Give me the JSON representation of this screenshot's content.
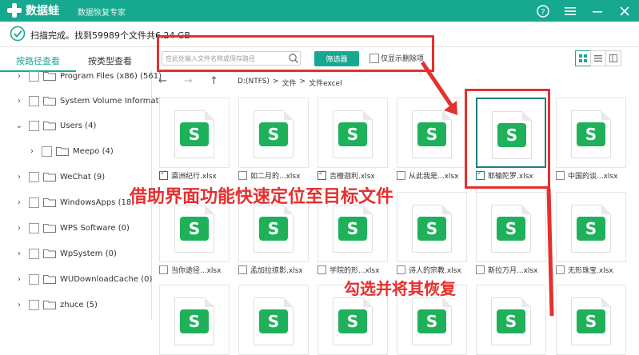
{
  "app": {
    "name": "数据蛙",
    "subtitle": "数据恢复专家"
  },
  "titlebar_icons": [
    "help-icon",
    "menu-icon",
    "minimize-icon",
    "close-icon"
  ],
  "status": {
    "text": "扫描完成。找到59989个文件共6.24 GB"
  },
  "tabs": [
    {
      "label": "按路径查看",
      "active": true
    },
    {
      "label": "按类型查看",
      "active": false
    }
  ],
  "tree": [
    {
      "label": "Program Files (x86) (561)",
      "expanded": false,
      "level": 0
    },
    {
      "label": "System Volume Informatio",
      "expanded": false,
      "level": 0
    },
    {
      "label": "Users (4)",
      "expanded": true,
      "level": 0
    },
    {
      "label": "Meepo (4)",
      "expanded": false,
      "level": 1
    },
    {
      "label": "WeChat (9)",
      "expanded": false,
      "level": 0
    },
    {
      "label": "WindowsApps (18)",
      "expanded": false,
      "level": 0
    },
    {
      "label": "WPS Software (0)",
      "expanded": false,
      "level": 0
    },
    {
      "label": "WpSystem (0)",
      "expanded": false,
      "level": 0
    },
    {
      "label": "WUDownloadCache (0)",
      "expanded": false,
      "level": 0
    },
    {
      "label": "zhuce (5)",
      "expanded": false,
      "level": 0
    }
  ],
  "search": {
    "placeholder": "在此处输入文件名称或保存路径"
  },
  "filter_button": "筛选器",
  "deleted_only_label": "仅显示删除项",
  "breadcrumb": [
    "D:(NTFS)",
    ">",
    "文件",
    ">",
    "文件excel"
  ],
  "files": [
    {
      "name": "瀛洲纪行.xlsx",
      "checked": true,
      "selected": false
    },
    {
      "name": "如二月的...xlsx",
      "checked": false,
      "selected": false
    },
    {
      "name": "吉檀迦利.xlsx",
      "checked": true,
      "selected": false
    },
    {
      "name": "从此我是...xlsx",
      "checked": false,
      "selected": false
    },
    {
      "name": "耶输陀罗.xlsx",
      "checked": true,
      "selected": true
    },
    {
      "name": "中国的谈...xlsx",
      "checked": false,
      "selected": false
    },
    {
      "name": "当你途径...xlsx",
      "checked": false,
      "selected": false
    },
    {
      "name": "孟加拉掠影.xlsx",
      "checked": false,
      "selected": false
    },
    {
      "name": "学院的形...xlsx",
      "checked": false,
      "selected": false
    },
    {
      "name": "诗人的宗教.xlsx",
      "checked": false,
      "selected": false
    },
    {
      "name": "斯拉万月...xlsx",
      "checked": false,
      "selected": false
    },
    {
      "name": "无形珠宝.xlsx",
      "checked": false,
      "selected": false
    },
    {
      "name": "",
      "checked": false,
      "selected": false
    },
    {
      "name": "",
      "checked": false,
      "selected": false
    },
    {
      "name": "",
      "checked": false,
      "selected": false
    },
    {
      "name": "",
      "checked": false,
      "selected": false
    },
    {
      "name": "",
      "checked": false,
      "selected": false
    },
    {
      "name": "",
      "checked": false,
      "selected": false
    }
  ],
  "file_badge": "S",
  "annotations": {
    "locate": "借助界面功能快速定位至目标文件",
    "restore": "勾选并将其恢复"
  },
  "colors": {
    "brand": "#16a98f",
    "annotation": "#e5302f",
    "sheet_badge": "#1eb15a",
    "selected_border": "#1d7f78"
  }
}
